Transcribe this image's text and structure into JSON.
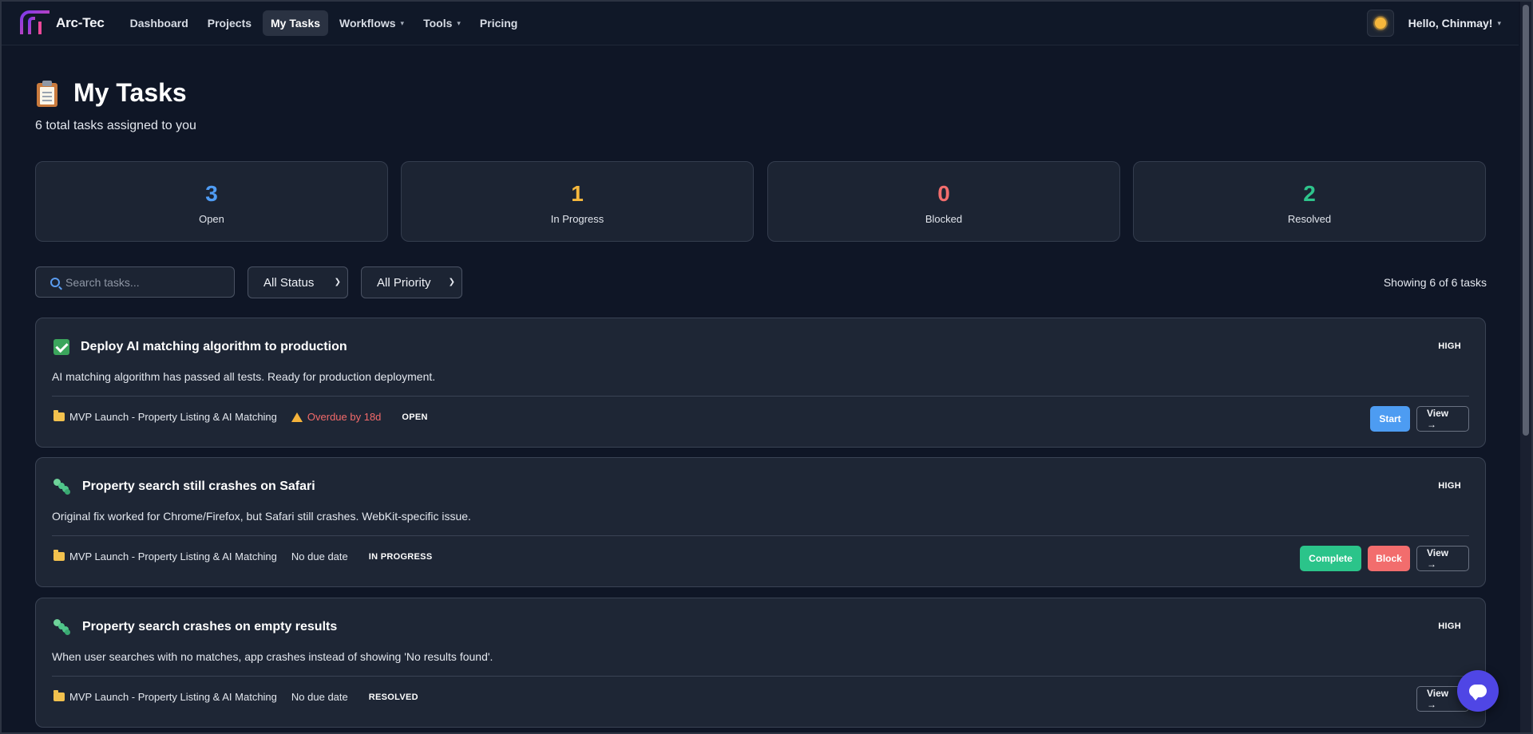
{
  "nav": {
    "brand": "Arc-Tec",
    "links": [
      {
        "label": "Dashboard",
        "dropdown": false,
        "active": false
      },
      {
        "label": "Projects",
        "dropdown": false,
        "active": false
      },
      {
        "label": "My Tasks",
        "dropdown": false,
        "active": true
      },
      {
        "label": "Workflows",
        "dropdown": true,
        "active": false
      },
      {
        "label": "Tools",
        "dropdown": true,
        "active": false
      },
      {
        "label": "Pricing",
        "dropdown": false,
        "active": false
      }
    ],
    "greeting": "Hello, Chinmay!",
    "theme_icon": "sun-icon"
  },
  "header": {
    "title": "My Tasks",
    "icon": "clipboard-icon",
    "subtitle": "6 total tasks assigned to you"
  },
  "stats": [
    {
      "value": "3",
      "label": "Open",
      "color": "#4f9cf4"
    },
    {
      "value": "1",
      "label": "In Progress",
      "color": "#f5b83d"
    },
    {
      "value": "0",
      "label": "Blocked",
      "color": "#f26d6d"
    },
    {
      "value": "2",
      "label": "Resolved",
      "color": "#2ec48c"
    }
  ],
  "filters": {
    "search_placeholder": "Search tasks...",
    "search_value": "",
    "status": "All Status",
    "priority": "All Priority",
    "showing": "Showing 6 of 6 tasks"
  },
  "tasks": [
    {
      "icon": "check-icon",
      "title": "Deploy AI matching algorithm to production",
      "priority": "HIGH",
      "description": "AI matching algorithm has passed all tests. Ready for production deployment.",
      "project": "MVP Launch - Property Listing & AI Matching",
      "due": "Overdue by 18d",
      "status": "OPEN",
      "actions": [
        "Start",
        "View →"
      ]
    },
    {
      "icon": "bug-icon",
      "title": "Property search still crashes on Safari",
      "priority": "HIGH",
      "description": "Original fix worked for Chrome/Firefox, but Safari still crashes. WebKit-specific issue.",
      "project": "MVP Launch - Property Listing & AI Matching",
      "due": "No due date",
      "status": "IN PROGRESS",
      "actions": [
        "Complete",
        "Block",
        "View →"
      ]
    },
    {
      "icon": "bug-icon",
      "title": "Property search crashes on empty results",
      "priority": "HIGH",
      "description": "When user searches with no matches, app crashes instead of showing 'No results found'.",
      "project": "MVP Launch - Property Listing & AI Matching",
      "due": "No due date",
      "status": "RESOLVED",
      "actions": [
        "View →"
      ]
    }
  ],
  "fab": {
    "icon": "chat-icon"
  }
}
